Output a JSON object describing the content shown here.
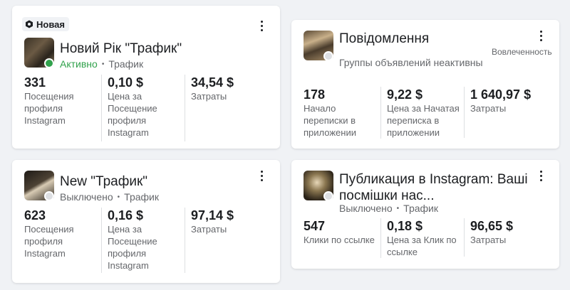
{
  "cards": [
    {
      "badge": "Новая",
      "title": "Новий Рік \"Трафик\"",
      "status": "Активно",
      "objective": "Трафик",
      "metrics": [
        {
          "value": "331",
          "label": "Посещения профиля Instagram"
        },
        {
          "value": "0,10 $",
          "label": "Цена за Посещение профиля Instagram"
        },
        {
          "value": "34,54 $",
          "label": "Затраты"
        }
      ]
    },
    {
      "title": "Повідомлення",
      "subtitle": "Группы объявлений неактивны",
      "note": "Вовлеченность",
      "metrics": [
        {
          "value": "178",
          "label": "Начало переписки в приложении"
        },
        {
          "value": "9,22 $",
          "label": "Цена за Начатая переписка в приложении"
        },
        {
          "value": "1 640,97 $",
          "label": "Затраты"
        }
      ]
    },
    {
      "title": "New \"Трафик\"",
      "status": "Выключено",
      "objective": "Трафик",
      "metrics": [
        {
          "value": "623",
          "label": "Посещения профиля Instagram"
        },
        {
          "value": "0,16 $",
          "label": "Цена за Посещение профиля Instagram"
        },
        {
          "value": "97,14 $",
          "label": "Затраты"
        }
      ]
    },
    {
      "title_line1": "Публикация в Instagram: Ваші",
      "title_line2": "посмішки нас...",
      "status": "Выключено",
      "objective": "Трафик",
      "metrics": [
        {
          "value": "547",
          "label": "Клики по ссылке"
        },
        {
          "value": "0,18 $",
          "label": "Цена за Клик по ссылке"
        },
        {
          "value": "96,65 $",
          "label": "Затраты"
        }
      ]
    }
  ],
  "colors": {
    "active": "#31a24c",
    "inactive": "#dddfe2"
  },
  "icons": {
    "badge": "hexagon-icon",
    "menu": "more-vertical-icon"
  }
}
